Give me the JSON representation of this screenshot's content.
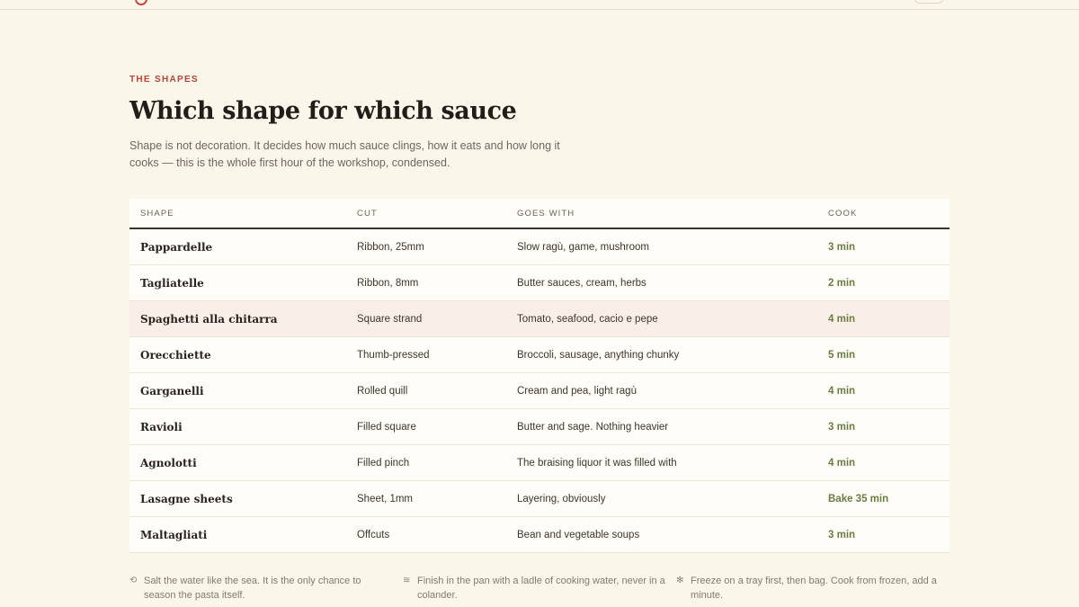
{
  "section": {
    "eyebrow": "THE SHAPES",
    "title": "Which shape for which sauce",
    "intro": "Shape is not decoration. It decides how much sauce clings, how it eats and how long it cooks — this is the whole first hour of the workshop, condensed."
  },
  "table": {
    "headers": [
      "SHAPE",
      "CUT",
      "GOES WITH",
      "COOK"
    ],
    "rows": [
      {
        "shape": "Pappardelle",
        "cut": "Ribbon, 25mm",
        "goes_with": "Slow ragù, game, mushroom",
        "cook": "3 min"
      },
      {
        "shape": "Tagliatelle",
        "cut": "Ribbon, 8mm",
        "goes_with": "Butter sauces, cream, herbs",
        "cook": "2 min"
      },
      {
        "shape": "Spaghetti alla chitarra",
        "cut": "Square strand",
        "goes_with": "Tomato, seafood, cacio e pepe",
        "cook": "4 min"
      },
      {
        "shape": "Orecchiette",
        "cut": "Thumb-pressed",
        "goes_with": "Broccoli, sausage, anything chunky",
        "cook": "5 min"
      },
      {
        "shape": "Garganelli",
        "cut": "Rolled quill",
        "goes_with": "Cream and pea, light ragù",
        "cook": "4 min"
      },
      {
        "shape": "Ravioli",
        "cut": "Filled square",
        "goes_with": "Butter and sage. Nothing heavier",
        "cook": "3 min"
      },
      {
        "shape": "Agnolotti",
        "cut": "Filled pinch",
        "goes_with": "The braising liquor it was filled with",
        "cook": "4 min"
      },
      {
        "shape": "Lasagne sheets",
        "cut": "Sheet, 1mm",
        "goes_with": "Layering, obviously",
        "cook": "Bake 35 min"
      },
      {
        "shape": "Maltagliati",
        "cut": "Offcuts",
        "goes_with": "Bean and vegetable soups",
        "cook": "3 min"
      }
    ]
  },
  "tips": [
    {
      "icon": "salt-icon",
      "glyph": "⟲",
      "text": "Salt the water like the sea. It is the only chance to season the pasta itself."
    },
    {
      "icon": "pan-icon",
      "glyph": "≋",
      "text": "Finish in the pan with a ladle of cooking water, never in a colander."
    },
    {
      "icon": "snowflake-icon",
      "glyph": "✻",
      "text": "Freeze on a tray first, then bag. Cook from frozen, add a minute."
    }
  ],
  "colors": {
    "background": "#faf6ea",
    "accent": "#b5453a",
    "cook_time": "#6b7c43",
    "highlight_row": "#f9efe8"
  }
}
